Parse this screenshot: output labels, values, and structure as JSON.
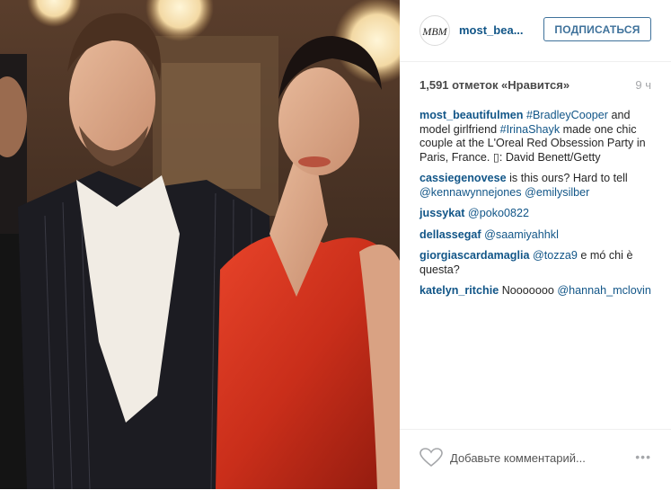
{
  "photo": {
    "alt_icon": "photo-image"
  },
  "header": {
    "avatar_text": "MBM",
    "username": "most_bea...",
    "follow_label": "ПОДПИСАТЬСЯ"
  },
  "stats": {
    "likes": "1,591 отметок «Нравится»",
    "time": "9 ч"
  },
  "caption": {
    "user": "most_beautifulmen",
    "tag1": "#BradleyCooper",
    "text1": " and model girlfriend ",
    "tag2": "#IrinaShayk",
    "text2": " made one chic couple at the L'Oreal Red Obsession Party in Paris, France. ",
    "glyph": "▯",
    "text3": ": David Benett/Getty"
  },
  "comments": [
    {
      "user": "cassiegenovese",
      "text": " is this ours? Hard to tell ",
      "mentions": "@kennawynnejones @emilysilber"
    },
    {
      "user": "jussykat",
      "text": " ",
      "mentions": "@poko0822"
    },
    {
      "user": "dellassegaf",
      "text": " ",
      "mentions": "@saamiyahhkl"
    },
    {
      "user": "giorgiascardamaglia",
      "text": " ",
      "mentions": "@tozza9",
      "text_after": " e mó chi è questa?"
    },
    {
      "user": "katelyn_ritchie",
      "text": " Nooooooo ",
      "mentions": "@hannah_mclovin"
    }
  ],
  "footer": {
    "add_comment_placeholder": "Добавьте комментарий...",
    "more_label": "•••"
  },
  "colors": {
    "link": "#125688",
    "follow": "#3f729b",
    "muted": "#a5a7aa"
  }
}
